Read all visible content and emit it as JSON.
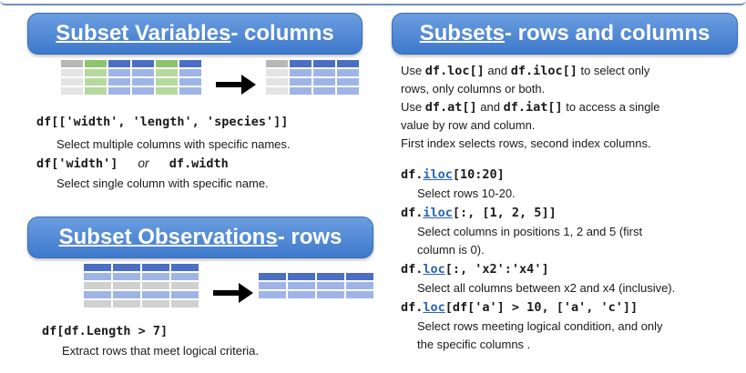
{
  "colors": {
    "banner_top": "#6a9ee0",
    "banner_bottom": "#3f79cc",
    "cell_blue": "#6f8fd6",
    "cell_blue_dark": "#4a6fc4",
    "cell_green": "#8ec46b",
    "cell_gray": "#b7b7b7",
    "cell_light": "#e3e3e3",
    "cell_lightblue": "#9fb4e6"
  },
  "left_top": {
    "banner_main": "Subset Variables",
    "banner_rest": " - columns",
    "code1": "df[['width', 'length', 'species']]",
    "desc1": "Select multiple columns with specific names.",
    "code2a": "df['width']",
    "code2_or": "or",
    "code2b": "df.width",
    "desc2": "Select single column with specific name."
  },
  "left_bottom": {
    "banner_main": "Subset Observations",
    "banner_rest": " - rows",
    "code1": "df[df.Length > 7]",
    "desc1": "Extract rows that meet logical criteria."
  },
  "right": {
    "banner_main": "Subsets",
    "banner_rest": " - rows and columns",
    "intro": {
      "l1_pre": "Use ",
      "l1_c1": "df.loc[]",
      "l1_mid": " and ",
      "l1_c2": "df.iloc[]",
      "l1_post": " to select only",
      "l2": "rows, only columns or both.",
      "l3_pre": "Use ",
      "l3_c1": "df.at[]",
      "l3_mid": " and ",
      "l3_c2": "df.iat[]",
      "l3_post": " to access a single",
      "l4": "value by row and column.",
      "l5": "First index selects rows, second index columns."
    },
    "items": [
      {
        "prefix": "df.",
        "fn": "iloc",
        "args": "[10:20]",
        "desc": [
          "Select rows 10-20."
        ]
      },
      {
        "prefix": "df.",
        "fn": "iloc",
        "args": "[:, [1, 2, 5]]",
        "desc": [
          "Select columns in positions 1, 2 and 5 (first",
          "column is 0)."
        ]
      },
      {
        "prefix": "df.",
        "fn": "loc",
        "args": "[:, 'x2':'x4']",
        "desc": [
          "Select all columns between x2 and x4 (inclusive)."
        ]
      },
      {
        "prefix": "df.",
        "fn": "loc",
        "args": "[df['a'] > 10, ['a', 'c']]",
        "desc": [
          "Select rows meeting logical condition, and only",
          "the specific columns ."
        ]
      }
    ]
  }
}
